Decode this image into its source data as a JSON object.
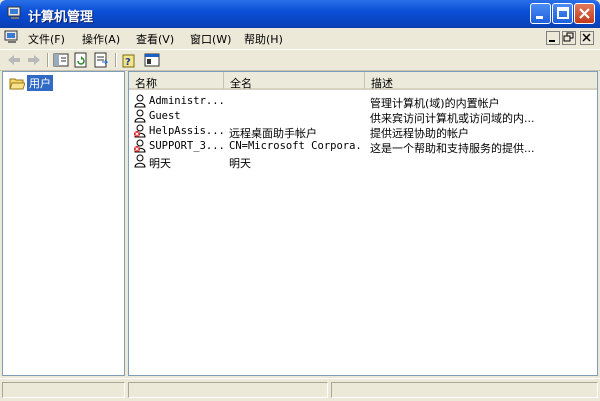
{
  "window": {
    "title": "计算机管理"
  },
  "menu": {
    "items": [
      {
        "label": "文件(F)"
      },
      {
        "label": "操作(A)"
      },
      {
        "label": "查看(V)"
      },
      {
        "label": "窗口(W)"
      },
      {
        "label": "帮助(H)"
      }
    ]
  },
  "toolbar": {
    "icons": [
      "back-icon",
      "forward-icon",
      "show-hide-tree-icon",
      "refresh-icon",
      "export-list-icon",
      "help-icon",
      "properties-icon"
    ]
  },
  "tree": {
    "selected_label": "用户"
  },
  "list": {
    "columns": [
      "名称",
      "全名",
      "描述"
    ],
    "rows": [
      {
        "name": "Administr...",
        "fullname": "",
        "description": "管理计算机(域)的内置帐户",
        "disabled": false
      },
      {
        "name": "Guest",
        "fullname": "",
        "description": "供来宾访问计算机或访问域的内...",
        "disabled": false
      },
      {
        "name": "HelpAssis...",
        "fullname": "远程桌面助手帐户",
        "description": "提供远程协助的帐户",
        "disabled": true
      },
      {
        "name": "SUPPORT_3...",
        "fullname": "CN=Microsoft Corpora...",
        "description": "这是一个帮助和支持服务的提供...",
        "disabled": true
      },
      {
        "name": "明天",
        "fullname": "明天",
        "description": "",
        "disabled": false
      }
    ]
  },
  "colors": {
    "titlebar": "#0a4fd6",
    "selection": "#316ac5",
    "disabled_user_mark": "#d42020"
  }
}
